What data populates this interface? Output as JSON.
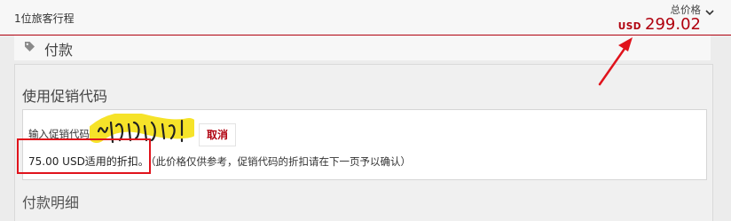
{
  "summary": {
    "trip_label": "1位旅客行程",
    "total_label": "总价格",
    "currency": "USD",
    "amount": "299.02"
  },
  "payment": {
    "title": "付款"
  },
  "promo": {
    "section_title": "使用促销代码",
    "input_label": "输入促销代码",
    "input_value": "",
    "cancel_label": "取消",
    "result_text": "75.00 USD适用的折扣。",
    "note_text": "（此价格仅供参考，促销代码的折扣请在下一页予以确认）"
  },
  "details": {
    "title": "付款明细"
  },
  "colors": {
    "accent": "#b0000e",
    "highlight": "#e0131c",
    "scribble_marker": "#f5e21e"
  },
  "icons": {
    "tag": "tag-icon",
    "chevron": "chevron-down-icon"
  }
}
